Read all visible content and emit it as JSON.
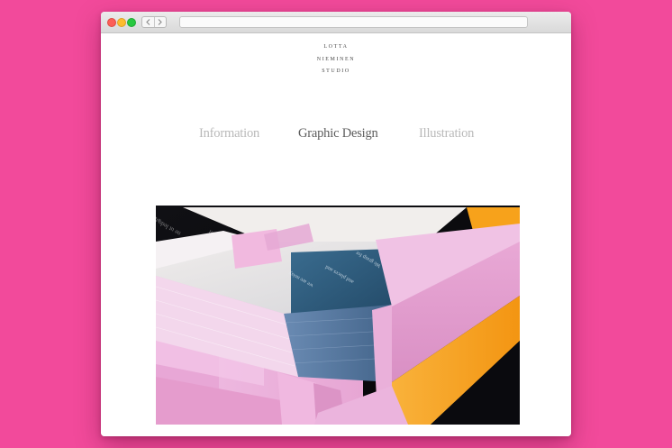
{
  "browser": {
    "back_icon": "chevron-left-icon",
    "forward_icon": "chevron-right-icon",
    "address": ""
  },
  "site": {
    "logo_lines": [
      "LOTTA",
      "NIEMINEN",
      "STUDIO"
    ]
  },
  "nav": {
    "items": [
      {
        "label": "Information",
        "active": false
      },
      {
        "label": "Graphic Design",
        "active": true
      },
      {
        "label": "Illustration",
        "active": false
      }
    ]
  },
  "colors": {
    "background": "#f24a9b",
    "nav_active": "#5c5c5c",
    "nav_inactive": "#b9b9b9",
    "box_pink": "#eeb0dc",
    "accent_orange": "#f7a21b",
    "book_blue": "#2d5d80"
  }
}
